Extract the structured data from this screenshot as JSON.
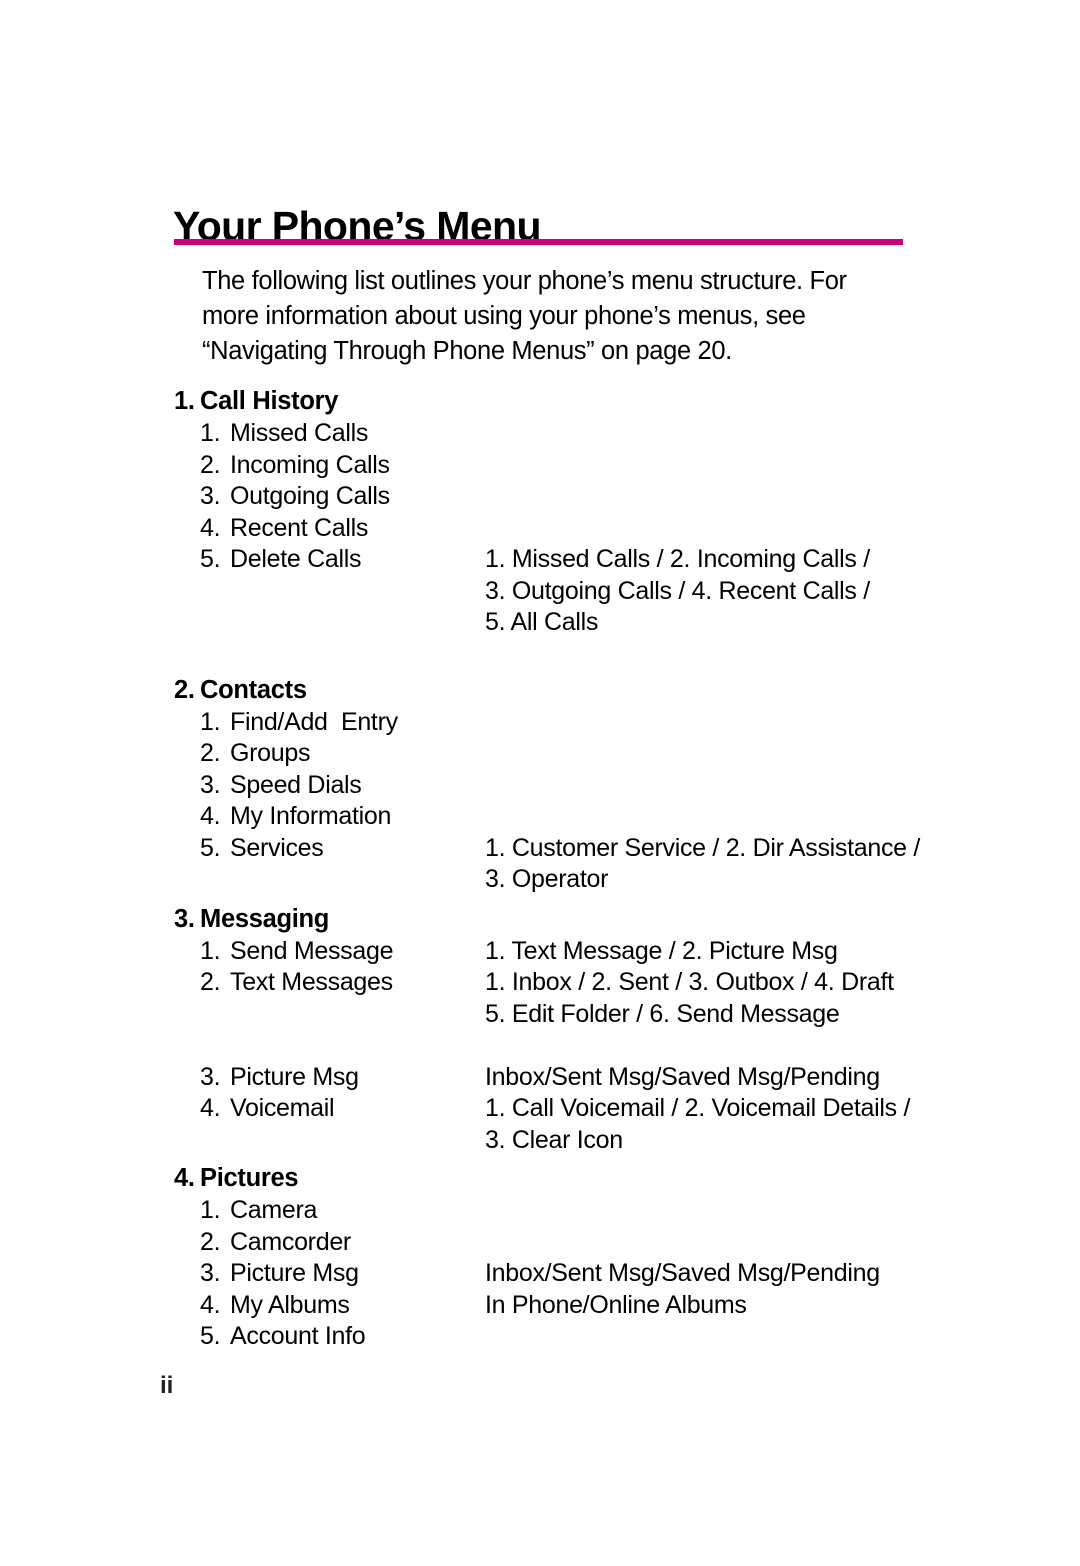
{
  "document": {
    "title": "Your Phone’s Menu",
    "rule_color": "#cc0077",
    "folio": "ii",
    "intro": "The following list outlines your phone’s menu structure. For more information about using your phone’s menus, see “Navigating Through Phone Menus” on page 20."
  },
  "sections": [
    {
      "number": "1.",
      "title": "Call History",
      "items": [
        {
          "number": "1.",
          "label": "Missed Calls",
          "detail": ""
        },
        {
          "number": "2.",
          "label": "Incoming Calls",
          "detail": ""
        },
        {
          "number": "3.",
          "label": "Outgoing Calls",
          "detail": ""
        },
        {
          "number": "4.",
          "label": "Recent Calls",
          "detail": ""
        },
        {
          "number": "5.",
          "label": "Delete Calls",
          "detail": "1. Missed Calls / 2. Incoming Calls /\n3. Outgoing Calls / 4. Recent Calls /\n5. All Calls"
        }
      ]
    },
    {
      "number": "2.",
      "title": "Contacts",
      "items": [
        {
          "number": "1.",
          "label": "Find/Add  Entry",
          "detail": ""
        },
        {
          "number": "2.",
          "label": "Groups",
          "detail": ""
        },
        {
          "number": "3.",
          "label": "Speed Dials",
          "detail": ""
        },
        {
          "number": "4.",
          "label": "My Information",
          "detail": ""
        },
        {
          "number": "5.",
          "label": "Services",
          "detail": "1. Customer Service / 2. Dir Assistance /\n3. Operator"
        }
      ]
    },
    {
      "number": "3.",
      "title": "Messaging",
      "items": [
        {
          "number": "1.",
          "label": "Send Message",
          "detail": "1. Text Message / 2. Picture Msg"
        },
        {
          "number": "2.",
          "label": "Text Messages",
          "detail": "1. Inbox / 2. Sent / 3. Outbox / 4. Draft\n5. Edit Folder / 6. Send Message"
        },
        {
          "number": "3.",
          "label": "Picture Msg",
          "detail": "Inbox/Sent Msg/Saved Msg/Pending"
        },
        {
          "number": "4.",
          "label": "Voicemail",
          "detail": "1. Call Voicemail / 2. Voicemail Details /\n3. Clear Icon"
        }
      ]
    },
    {
      "number": "4.",
      "title": "Pictures",
      "items": [
        {
          "number": "1.",
          "label": "Camera",
          "detail": ""
        },
        {
          "number": "2.",
          "label": "Camcorder",
          "detail": ""
        },
        {
          "number": "3.",
          "label": "Picture Msg",
          "detail": "Inbox/Sent Msg/Saved Msg/Pending"
        },
        {
          "number": "4.",
          "label": "My Albums",
          "detail": "In Phone/Online Albums"
        },
        {
          "number": "5.",
          "label": "Account Info",
          "detail": ""
        }
      ]
    }
  ]
}
